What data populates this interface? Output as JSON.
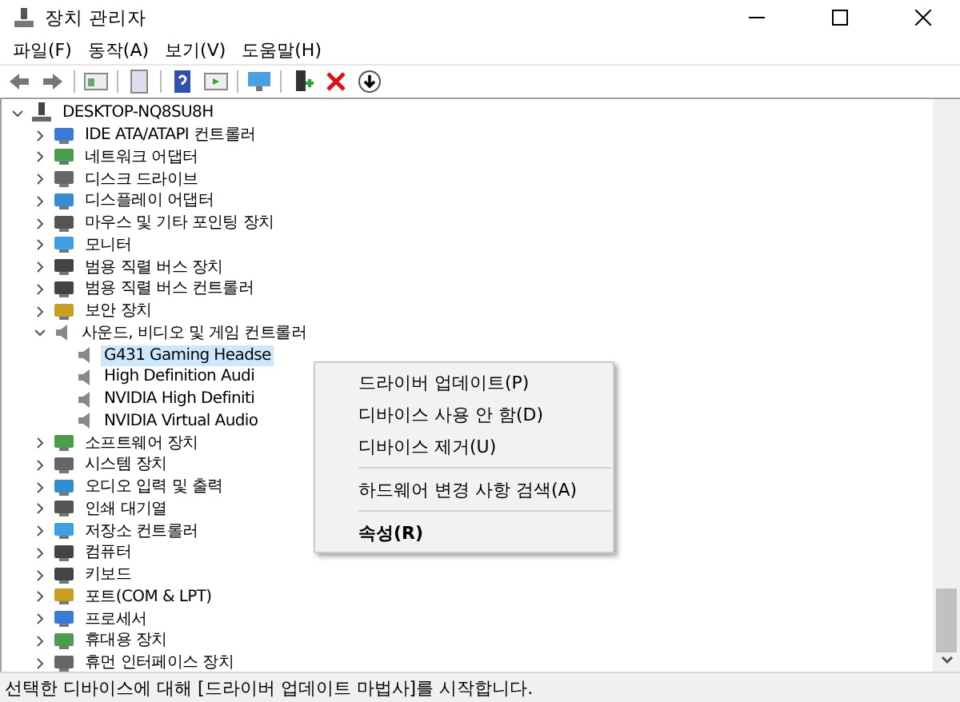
{
  "window": {
    "title": "장치 관리자"
  },
  "menu": [
    "파일(F)",
    "동작(A)",
    "보기(V)",
    "도움말(H)"
  ],
  "tree": {
    "label": "DESKTOP-NQ8SU8H",
    "expanded": true,
    "children": [
      {
        "label": "IDE ATA/ATAPI 컨트롤러",
        "expanded": false,
        "selected": false
      },
      {
        "label": "네트워크 어댑터",
        "expanded": false,
        "selected": false
      },
      {
        "label": "디스크 드라이브",
        "expanded": false,
        "selected": false
      },
      {
        "label": "디스플레이 어댑터",
        "expanded": false,
        "selected": false
      },
      {
        "label": "마우스 및 기타 포인팅 장치",
        "expanded": false,
        "selected": false
      },
      {
        "label": "모니터",
        "expanded": false,
        "selected": false
      },
      {
        "label": "범용 직렬 버스 장치",
        "expanded": false,
        "selected": false
      },
      {
        "label": "범용 직렬 버스 컨트롤러",
        "expanded": false,
        "selected": false
      },
      {
        "label": "보안 장치",
        "expanded": false,
        "selected": false
      },
      {
        "label": "사운드, 비디오 및 게임 컨트롤러",
        "expanded": true,
        "selected": false,
        "children": [
          {
            "label": "G431 Gaming Headse",
            "selected": true
          },
          {
            "label": "High Definition Audi",
            "selected": false
          },
          {
            "label": "NVIDIA High Definiti",
            "selected": false
          },
          {
            "label": "NVIDIA Virtual Audio",
            "selected": false
          }
        ]
      },
      {
        "label": "소프트웨어 장치",
        "expanded": false,
        "selected": false
      },
      {
        "label": "시스템 장치",
        "expanded": false,
        "selected": false
      },
      {
        "label": "오디오 입력 및 출력",
        "expanded": false,
        "selected": false
      },
      {
        "label": "인쇄 대기열",
        "expanded": false,
        "selected": false
      },
      {
        "label": "저장소 컨트롤러",
        "expanded": false,
        "selected": false
      },
      {
        "label": "컴퓨터",
        "expanded": false,
        "selected": false
      },
      {
        "label": "키보드",
        "expanded": false,
        "selected": false
      },
      {
        "label": "포트(COM & LPT)",
        "expanded": false,
        "selected": false
      },
      {
        "label": "프로세서",
        "expanded": false,
        "selected": false
      },
      {
        "label": "휴대용 장치",
        "expanded": false,
        "selected": false
      },
      {
        "label": "휴먼 인터페이스 장치",
        "expanded": false,
        "selected": false
      }
    ]
  },
  "context_menu": [
    {
      "label": "드라이버 업데이트(P)",
      "kind": "item"
    },
    {
      "label": "디바이스 사용 안 함(D)",
      "kind": "item"
    },
    {
      "label": "디바이스 제거(U)",
      "kind": "item"
    },
    {
      "kind": "separator"
    },
    {
      "label": "하드웨어 변경 사항 검색(A)",
      "kind": "item"
    },
    {
      "kind": "separator"
    },
    {
      "label": "속성(R)",
      "kind": "default"
    }
  ],
  "status_bar": "선택한 디바이스에 대해 [드라이버 업데이트 마법사]를 시작합니다."
}
